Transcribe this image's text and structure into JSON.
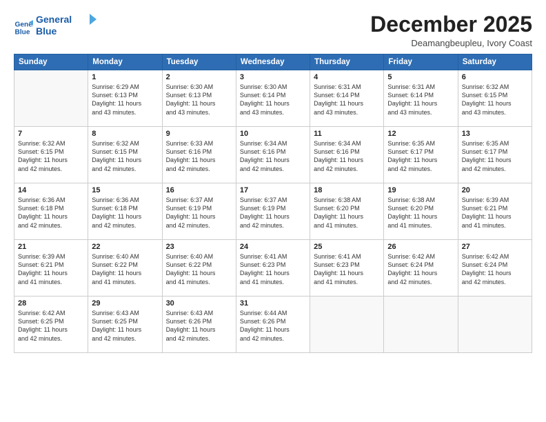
{
  "logo": {
    "line1": "General",
    "line2": "Blue"
  },
  "title": "December 2025",
  "subtitle": "Deamangbeupleu, Ivory Coast",
  "header_days": [
    "Sunday",
    "Monday",
    "Tuesday",
    "Wednesday",
    "Thursday",
    "Friday",
    "Saturday"
  ],
  "weeks": [
    [
      {
        "day": "",
        "info": ""
      },
      {
        "day": "1",
        "info": "Sunrise: 6:29 AM\nSunset: 6:13 PM\nDaylight: 11 hours\nand 43 minutes."
      },
      {
        "day": "2",
        "info": "Sunrise: 6:30 AM\nSunset: 6:13 PM\nDaylight: 11 hours\nand 43 minutes."
      },
      {
        "day": "3",
        "info": "Sunrise: 6:30 AM\nSunset: 6:14 PM\nDaylight: 11 hours\nand 43 minutes."
      },
      {
        "day": "4",
        "info": "Sunrise: 6:31 AM\nSunset: 6:14 PM\nDaylight: 11 hours\nand 43 minutes."
      },
      {
        "day": "5",
        "info": "Sunrise: 6:31 AM\nSunset: 6:14 PM\nDaylight: 11 hours\nand 43 minutes."
      },
      {
        "day": "6",
        "info": "Sunrise: 6:32 AM\nSunset: 6:15 PM\nDaylight: 11 hours\nand 43 minutes."
      }
    ],
    [
      {
        "day": "7",
        "info": "Sunrise: 6:32 AM\nSunset: 6:15 PM\nDaylight: 11 hours\nand 42 minutes."
      },
      {
        "day": "8",
        "info": "Sunrise: 6:32 AM\nSunset: 6:15 PM\nDaylight: 11 hours\nand 42 minutes."
      },
      {
        "day": "9",
        "info": "Sunrise: 6:33 AM\nSunset: 6:16 PM\nDaylight: 11 hours\nand 42 minutes."
      },
      {
        "day": "10",
        "info": "Sunrise: 6:34 AM\nSunset: 6:16 PM\nDaylight: 11 hours\nand 42 minutes."
      },
      {
        "day": "11",
        "info": "Sunrise: 6:34 AM\nSunset: 6:16 PM\nDaylight: 11 hours\nand 42 minutes."
      },
      {
        "day": "12",
        "info": "Sunrise: 6:35 AM\nSunset: 6:17 PM\nDaylight: 11 hours\nand 42 minutes."
      },
      {
        "day": "13",
        "info": "Sunrise: 6:35 AM\nSunset: 6:17 PM\nDaylight: 11 hours\nand 42 minutes."
      }
    ],
    [
      {
        "day": "14",
        "info": "Sunrise: 6:36 AM\nSunset: 6:18 PM\nDaylight: 11 hours\nand 42 minutes."
      },
      {
        "day": "15",
        "info": "Sunrise: 6:36 AM\nSunset: 6:18 PM\nDaylight: 11 hours\nand 42 minutes."
      },
      {
        "day": "16",
        "info": "Sunrise: 6:37 AM\nSunset: 6:19 PM\nDaylight: 11 hours\nand 42 minutes."
      },
      {
        "day": "17",
        "info": "Sunrise: 6:37 AM\nSunset: 6:19 PM\nDaylight: 11 hours\nand 42 minutes."
      },
      {
        "day": "18",
        "info": "Sunrise: 6:38 AM\nSunset: 6:20 PM\nDaylight: 11 hours\nand 41 minutes."
      },
      {
        "day": "19",
        "info": "Sunrise: 6:38 AM\nSunset: 6:20 PM\nDaylight: 11 hours\nand 41 minutes."
      },
      {
        "day": "20",
        "info": "Sunrise: 6:39 AM\nSunset: 6:21 PM\nDaylight: 11 hours\nand 41 minutes."
      }
    ],
    [
      {
        "day": "21",
        "info": "Sunrise: 6:39 AM\nSunset: 6:21 PM\nDaylight: 11 hours\nand 41 minutes."
      },
      {
        "day": "22",
        "info": "Sunrise: 6:40 AM\nSunset: 6:22 PM\nDaylight: 11 hours\nand 41 minutes."
      },
      {
        "day": "23",
        "info": "Sunrise: 6:40 AM\nSunset: 6:22 PM\nDaylight: 11 hours\nand 41 minutes."
      },
      {
        "day": "24",
        "info": "Sunrise: 6:41 AM\nSunset: 6:23 PM\nDaylight: 11 hours\nand 41 minutes."
      },
      {
        "day": "25",
        "info": "Sunrise: 6:41 AM\nSunset: 6:23 PM\nDaylight: 11 hours\nand 41 minutes."
      },
      {
        "day": "26",
        "info": "Sunrise: 6:42 AM\nSunset: 6:24 PM\nDaylight: 11 hours\nand 42 minutes."
      },
      {
        "day": "27",
        "info": "Sunrise: 6:42 AM\nSunset: 6:24 PM\nDaylight: 11 hours\nand 42 minutes."
      }
    ],
    [
      {
        "day": "28",
        "info": "Sunrise: 6:42 AM\nSunset: 6:25 PM\nDaylight: 11 hours\nand 42 minutes."
      },
      {
        "day": "29",
        "info": "Sunrise: 6:43 AM\nSunset: 6:25 PM\nDaylight: 11 hours\nand 42 minutes."
      },
      {
        "day": "30",
        "info": "Sunrise: 6:43 AM\nSunset: 6:26 PM\nDaylight: 11 hours\nand 42 minutes."
      },
      {
        "day": "31",
        "info": "Sunrise: 6:44 AM\nSunset: 6:26 PM\nDaylight: 11 hours\nand 42 minutes."
      },
      {
        "day": "",
        "info": ""
      },
      {
        "day": "",
        "info": ""
      },
      {
        "day": "",
        "info": ""
      }
    ]
  ]
}
